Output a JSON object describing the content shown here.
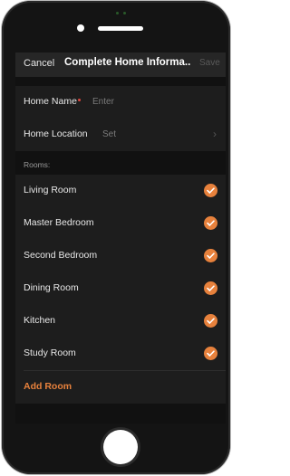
{
  "navbar": {
    "cancel_label": "Cancel",
    "title": "Complete Home Informa...",
    "save_label": "Save"
  },
  "form": {
    "home_name": {
      "label": "Home Name",
      "placeholder": "Enter"
    },
    "home_location": {
      "label": "Home Location",
      "value": "Set"
    }
  },
  "rooms": {
    "header": "Rooms:",
    "items": [
      {
        "label": "Living Room",
        "checked": true
      },
      {
        "label": "Master Bedroom",
        "checked": true
      },
      {
        "label": "Second Bedroom",
        "checked": true
      },
      {
        "label": "Dining Room",
        "checked": true
      },
      {
        "label": "Kitchen",
        "checked": true
      },
      {
        "label": "Study Room",
        "checked": true
      }
    ],
    "add_label": "Add Room"
  },
  "colors": {
    "accent": "#e7813c",
    "required": "#e0473f",
    "background": "#1d1d1d"
  }
}
